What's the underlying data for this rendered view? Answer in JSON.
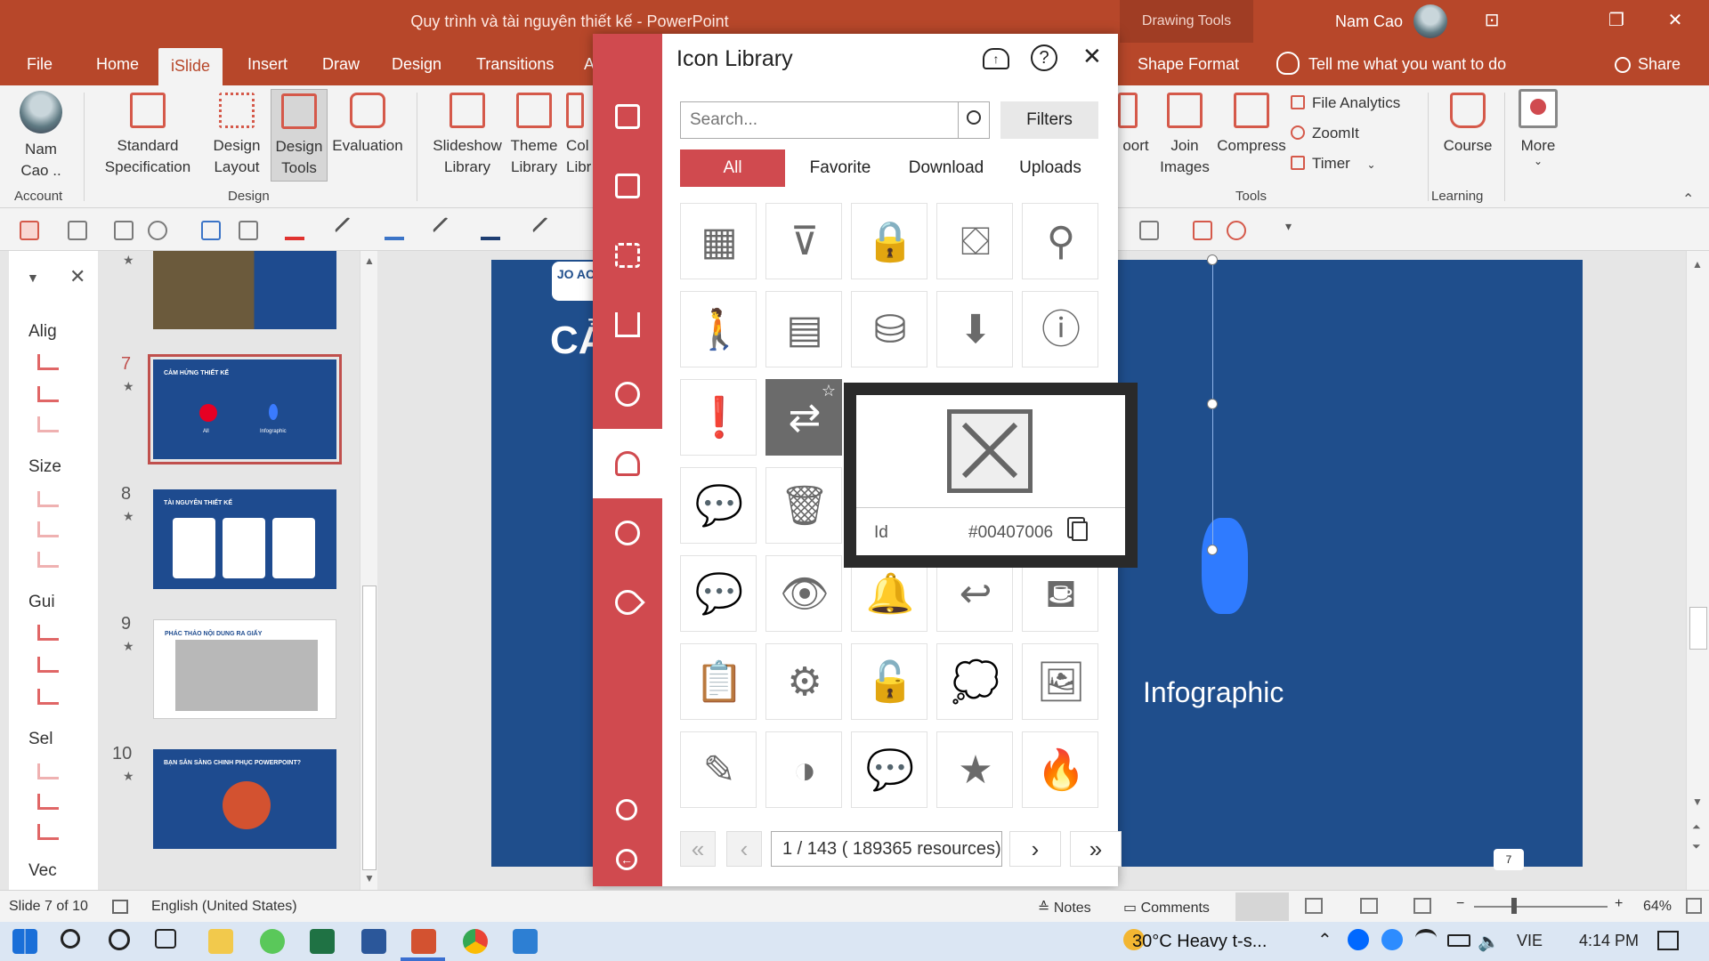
{
  "window": {
    "title": "Quy trình và tài nguyên thiết kế  -  PowerPoint",
    "context_tab": "Drawing Tools",
    "user": "Nam Cao"
  },
  "tabs": [
    "File",
    "Home",
    "iSlide",
    "Insert",
    "Draw",
    "Design",
    "Transitions",
    "A"
  ],
  "shape_format_tab": "Shape Format",
  "tell_me": "Tell me what you want to do",
  "share": "Share",
  "ribbon": {
    "account_label_1": "Nam",
    "account_label_2": "Cao ..",
    "account_group": "Account",
    "standard_1": "Standard",
    "standard_2": "Specification",
    "design_layout_1": "Design",
    "design_layout_2": "Layout",
    "design_tools_1": "Design",
    "design_tools_2": "Tools",
    "evaluation": "Evaluation",
    "design_group": "Design",
    "slideshow_1": "Slideshow",
    "slideshow_2": "Library",
    "theme_1": "Theme",
    "theme_2": "Library",
    "col_1": "Col",
    "col_2": "Libr",
    "export_partial": "oort",
    "join_1": "Join",
    "join_2": "Images",
    "compress": "Compress",
    "file_analytics": "File Analytics",
    "zoomit": "ZoomIt",
    "timer": "Timer",
    "tools_group": "Tools",
    "course": "Course",
    "learning_group": "Learning",
    "more": "More"
  },
  "left_pane": {
    "align": "Alig",
    "size": "Size",
    "guides": "Gui",
    "select": "Sel",
    "vector": "Vec"
  },
  "thumbnails": [
    {
      "num": "7",
      "title": "CẢM HỨNG THIẾT KẾ",
      "sub1": "All",
      "sub2": "Infographic"
    },
    {
      "num": "8",
      "title": "TÀI NGUYÊN THIẾT KẾ"
    },
    {
      "num": "9",
      "title": "PHÁC THẢO NỘI DUNG RA GIẤY"
    },
    {
      "num": "10",
      "title": "BẠN SẴN SÀNG CHINH PHỤC POWERPOINT?"
    }
  ],
  "slide": {
    "heading_partial": "CẢ",
    "logo": "JO AC",
    "infographic_label": "Infographic",
    "page_badge": "7"
  },
  "icon_library": {
    "title": "Icon Library",
    "search_placeholder": "Search...",
    "filters": "Filters",
    "filter_tabs": [
      "All",
      "Favorite",
      "Download",
      "Uploads"
    ],
    "tooltip_id_label": "Id",
    "tooltip_id_value": "#00407006",
    "pager": "1  / 143 ( 189365 resources)"
  },
  "status": {
    "slide": "Slide 7 of 10",
    "language": "English (United States)",
    "notes": "Notes",
    "comments": "Comments",
    "zoom": "64%"
  },
  "taskbar": {
    "weather": "30°C  Heavy t-s...",
    "lang": "VIE",
    "time": "4:14 PM"
  },
  "colors": {
    "accent": "#b7472a",
    "islide_red": "#d04a4f",
    "slide_blue": "#1f4e8c"
  }
}
